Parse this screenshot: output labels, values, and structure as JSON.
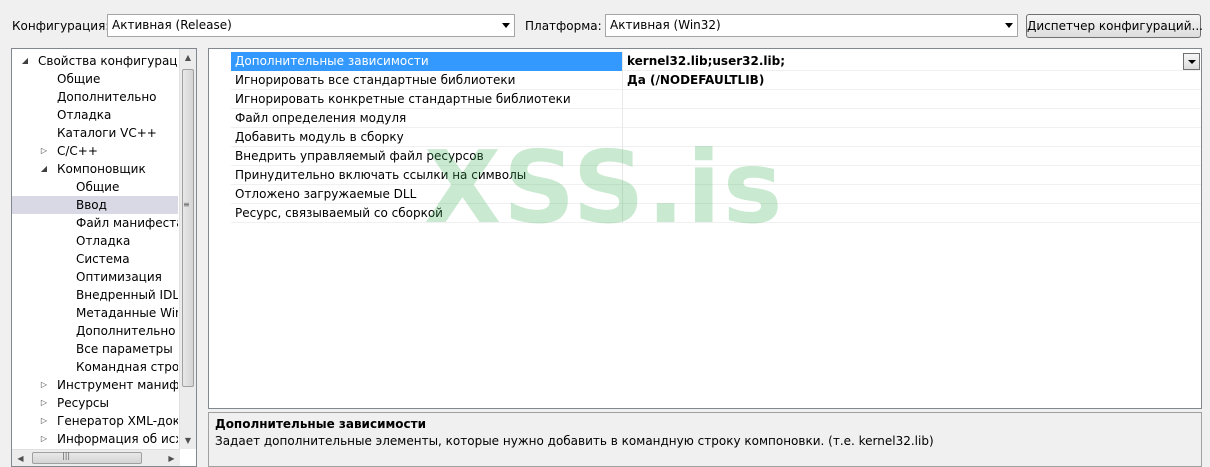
{
  "toolbar": {
    "config_label": "Конфигурация:",
    "config_value": "Активная (Release)",
    "platform_label": "Платформа:",
    "platform_value": "Активная (Win32)",
    "config_manager_label": "Диспетчер конфигураций..."
  },
  "tree": {
    "items": [
      {
        "label": "Свойства конфигурации",
        "expander": "expanded"
      },
      {
        "label": "Общие"
      },
      {
        "label": "Дополнительно"
      },
      {
        "label": "Отладка"
      },
      {
        "label": "Каталоги VC++"
      },
      {
        "label": "C/C++",
        "expander": "collapsed"
      },
      {
        "label": "Компоновщик",
        "expander": "expanded"
      },
      {
        "label": "Общие"
      },
      {
        "label": "Ввод",
        "selected": true
      },
      {
        "label": "Файл манифеста"
      },
      {
        "label": "Отладка"
      },
      {
        "label": "Система"
      },
      {
        "label": "Оптимизация"
      },
      {
        "label": "Внедренный IDL"
      },
      {
        "label": "Метаданные Windo"
      },
      {
        "label": "Дополнительно"
      },
      {
        "label": "Все параметры"
      },
      {
        "label": "Командная строка"
      },
      {
        "label": "Инструмент манифест",
        "expander": "collapsed"
      },
      {
        "label": "Ресурсы",
        "expander": "collapsed"
      },
      {
        "label": "Генератор XML-докум",
        "expander": "collapsed"
      },
      {
        "label": "Информация об исход",
        "expander": "collapsed"
      }
    ]
  },
  "grid": {
    "rows": [
      {
        "name": "Дополнительные зависимости",
        "value": "kernel32.lib;user32.lib;",
        "selected": true
      },
      {
        "name": "Игнорировать все стандартные библиотеки",
        "value": "Да (/NODEFAULTLIB)"
      },
      {
        "name": "Игнорировать конкретные стандартные библиотеки",
        "value": ""
      },
      {
        "name": "Файл определения модуля",
        "value": ""
      },
      {
        "name": "Добавить модуль в сборку",
        "value": ""
      },
      {
        "name": "Внедрить управляемый файл ресурсов",
        "value": ""
      },
      {
        "name": "Принудительно включать ссылки на символы",
        "value": ""
      },
      {
        "name": "Отложено загружаемые DLL",
        "value": ""
      },
      {
        "name": "Ресурс, связываемый со сборкой",
        "value": ""
      }
    ]
  },
  "description": {
    "title": "Дополнительные зависимости",
    "text": "Задает дополнительные элементы, которые нужно добавить в командную строку компоновки. (т.е. kernel32.lib)"
  },
  "watermark": "XSS.is",
  "colors": {
    "selection": "#3399ff",
    "tree_selection": "#d9d9e6",
    "watermark": "#3caf55"
  },
  "icons": {
    "expanded": "triangle-down-right-icon",
    "collapsed": "triangle-right-icon",
    "dropdown": "chevron-down-icon"
  }
}
